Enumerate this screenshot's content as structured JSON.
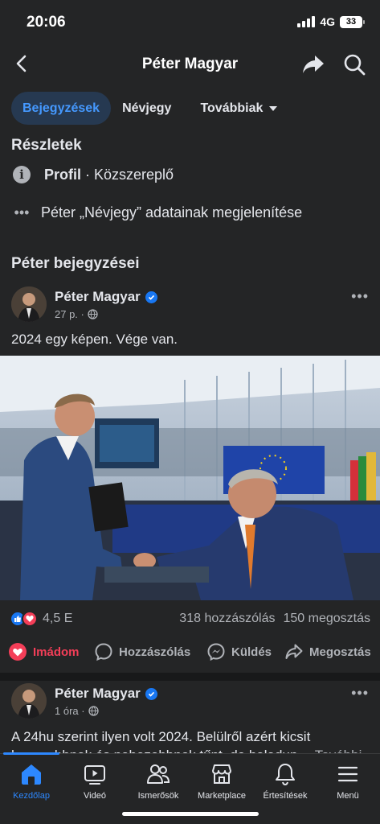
{
  "status": {
    "time": "20:06",
    "network": "4G",
    "battery": "33"
  },
  "header": {
    "title": "Péter Magyar",
    "icons": [
      "back-icon",
      "share-icon",
      "search-icon"
    ]
  },
  "tabs": [
    {
      "label": "Bejegyzések",
      "active": true
    },
    {
      "label": "Névjegy",
      "active": false
    },
    {
      "label": "Továbbiak",
      "active": false
    }
  ],
  "details": {
    "title": "Részletek",
    "profile_label": "Profil",
    "profile_type": " · Közszereplő",
    "about_link": "Péter „Névjegy” adatainak megjelenítése"
  },
  "posts_section": {
    "title": "Péter bejegyzései"
  },
  "post1": {
    "author": "Péter Magyar",
    "time": "27 p. ·",
    "text": "2024 egy képen. Vége van.",
    "reaction_count": "4,5 E",
    "comments": "318 hozzászólás",
    "shares": "150 megosztás"
  },
  "actions": {
    "love": "Imádom",
    "comment": "Hozzászólás",
    "send": "Küldés",
    "share": "Megosztás"
  },
  "post2": {
    "author": "Péter Magyar",
    "time": "1 óra ·",
    "line1": "A 24hu szerint ilyen volt 2024. Belülről azért kicsit",
    "line2": "hosszabbnak és nehezebbnek tűnt, de haladun",
    "more": "… További"
  },
  "nav": [
    {
      "label": "Kezdőlap",
      "icon": "home-icon",
      "active": true
    },
    {
      "label": "Videó",
      "icon": "video-icon",
      "active": false
    },
    {
      "label": "Ismerősök",
      "icon": "friends-icon",
      "active": false
    },
    {
      "label": "Marketplace",
      "icon": "marketplace-icon",
      "active": false
    },
    {
      "label": "Értesítések",
      "icon": "bell-icon",
      "active": false
    },
    {
      "label": "Menü",
      "icon": "menu-icon",
      "active": false
    }
  ],
  "colors": {
    "background": "#242526",
    "accent": "#2d88ff",
    "love": "#f33e58"
  }
}
